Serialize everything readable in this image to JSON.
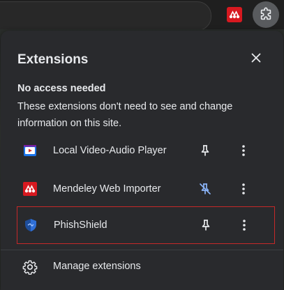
{
  "toolbar": {
    "extension_icon": "mendeley-icon",
    "extensions_button_icon": "puzzle-icon"
  },
  "popup": {
    "title": "Extensions",
    "close_icon": "close-icon",
    "section": {
      "title": "No access needed",
      "description": "These extensions don't need to see and change information on this site."
    },
    "extensions": [
      {
        "name": "Local Video-Audio Player",
        "icon": "video-player-icon",
        "pinned": false,
        "highlighted": false
      },
      {
        "name": "Mendeley Web Importer",
        "icon": "mendeley-icon",
        "pinned": true,
        "highlighted": false
      },
      {
        "name": "PhishShield",
        "icon": "shield-icon",
        "pinned": false,
        "highlighted": true
      }
    ],
    "manage": {
      "label": "Manage extensions",
      "icon": "gear-icon"
    }
  },
  "colors": {
    "popup_bg": "#292a2d",
    "text": "#e8eaed",
    "pinned_blue": "#8ab4f8",
    "highlight_border": "#c62828",
    "mendeley_red": "#d71920"
  }
}
